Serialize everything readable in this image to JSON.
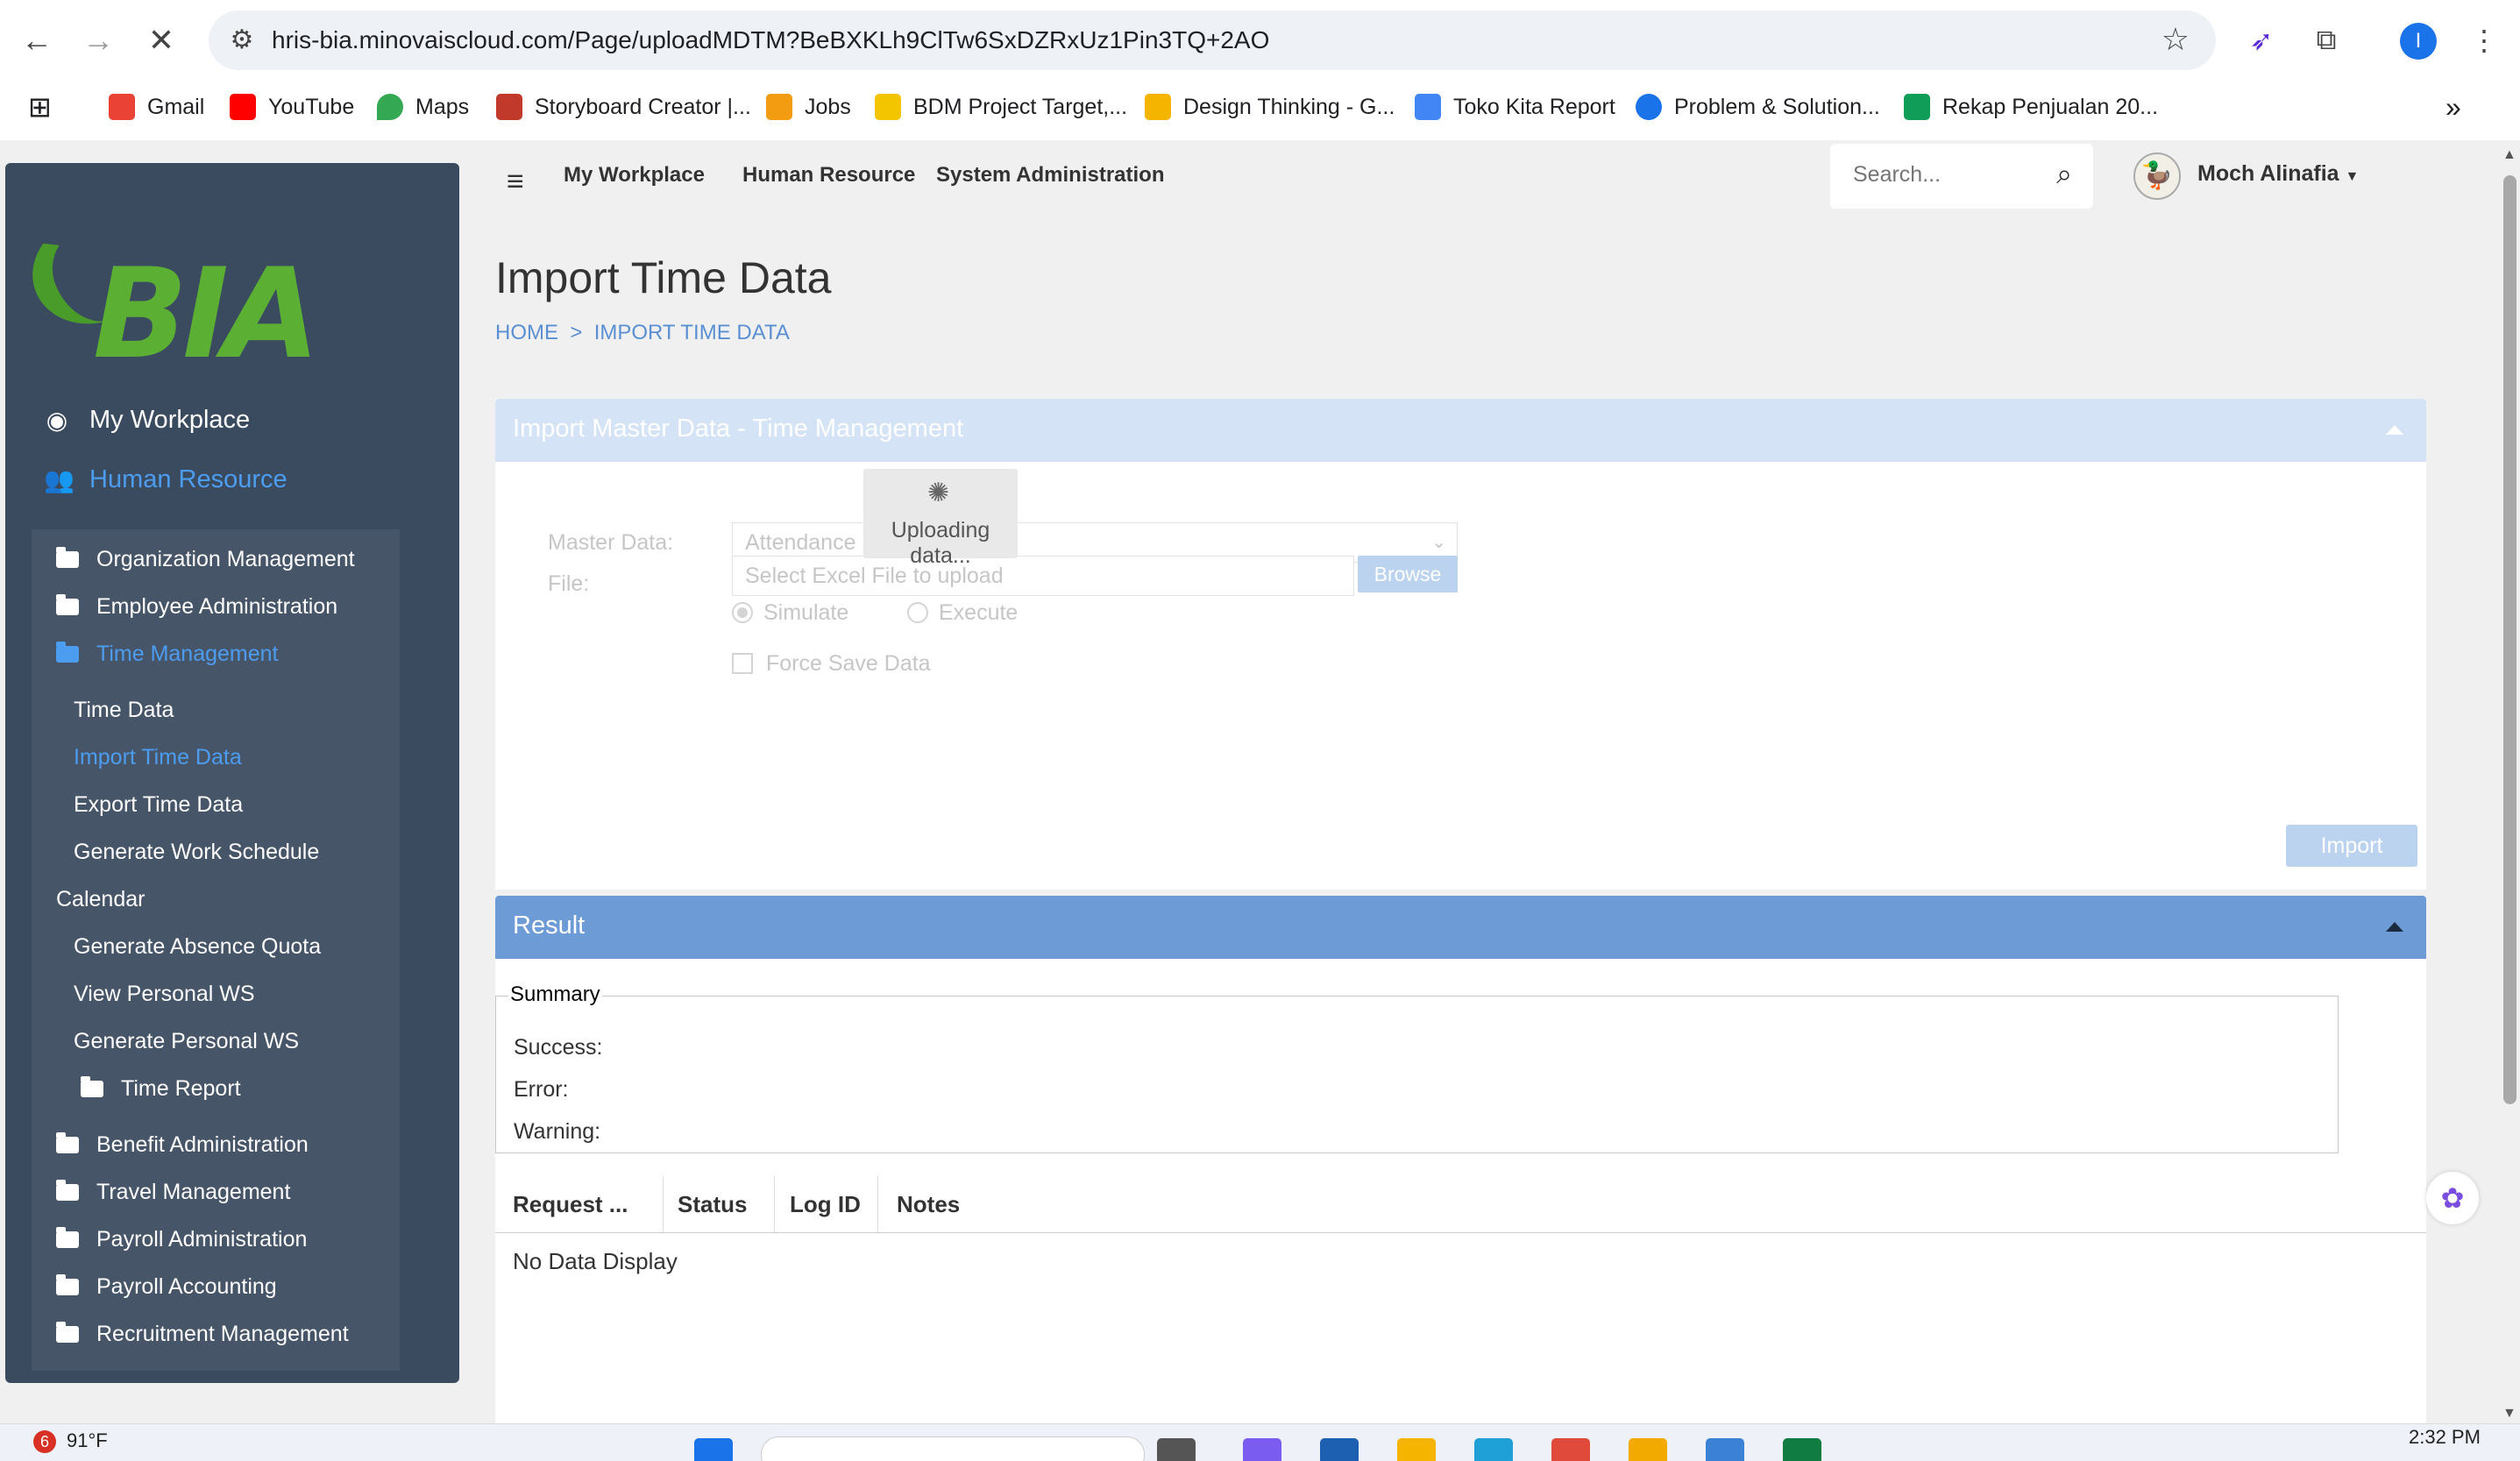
{
  "browser": {
    "url": "hris-bia.minovaiscloud.com/Page/uploadMDTM?BeBXKLh9ClTw6SxDZRxUz1Pin3TQ+2AO",
    "profile_initial": "I",
    "bookmarks": [
      {
        "label": "Gmail",
        "color": "#ea4335"
      },
      {
        "label": "YouTube",
        "color": "#ff0000"
      },
      {
        "label": "Maps",
        "color": "#34a853"
      },
      {
        "label": "Storyboard Creator |...",
        "color": "#c0392b"
      },
      {
        "label": "Jobs",
        "color": "#f39c12"
      },
      {
        "label": "BDM Project Target,...",
        "color": "#111111"
      },
      {
        "label": "Design Thinking - G...",
        "color": "#f4b400"
      },
      {
        "label": "Toko Kita Report",
        "color": "#4285f4"
      },
      {
        "label": "Problem & Solution...",
        "color": "#1a73e8"
      },
      {
        "label": "Rekap Penjualan 20...",
        "color": "#0f9d58"
      }
    ],
    "more_label": "»"
  },
  "sidebar": {
    "logo_text": "BIA",
    "top_items": [
      {
        "label": "My Workplace"
      },
      {
        "label": "Human Resource"
      }
    ],
    "submenu": [
      {
        "label": "Organization Management"
      },
      {
        "label": "Employee Administration"
      },
      {
        "label": "Time Management"
      }
    ],
    "time_children": [
      {
        "label": "Time Data"
      },
      {
        "label": "Import Time Data"
      },
      {
        "label": "Export Time Data"
      },
      {
        "label": "Generate Work Schedule"
      },
      {
        "label": "Calendar"
      },
      {
        "label": "Generate Absence Quota"
      },
      {
        "label": "View Personal WS"
      },
      {
        "label": "Generate Personal WS"
      },
      {
        "label": "Time Report"
      }
    ],
    "submenu_after": [
      {
        "label": "Benefit Administration"
      },
      {
        "label": "Travel Management"
      },
      {
        "label": "Payroll Administration"
      },
      {
        "label": "Payroll Accounting"
      },
      {
        "label": "Recruitment Management"
      }
    ]
  },
  "topbar": {
    "nav": [
      "My Workplace",
      "Human Resource",
      "System Administration"
    ],
    "search_placeholder": "Search...",
    "user_name": "Moch Alinafia"
  },
  "content": {
    "page_title": "Import Time Data",
    "breadcrumb": "HOME  >  IMPORT TIME DATA",
    "import_panel": {
      "title": "Import Master Data - Time Management",
      "master_data_label": "Master Data:",
      "master_data_value": "Attendance",
      "file_label": "File:",
      "file_placeholder": "Select Excel File to upload",
      "browse_label": "Browse",
      "simulate_label": "Simulate",
      "execute_label": "Execute",
      "force_save_label": "Force Save Data",
      "loading_text": "Uploading data...",
      "import_label": "Import"
    },
    "result_panel": {
      "title": "Result",
      "summary_label": "Summary",
      "success_label": "Success:",
      "error_label": "Error:",
      "warning_label": "Warning:",
      "columns": [
        "Request ...",
        "Status",
        "Log ID",
        "Notes"
      ],
      "empty_text": "No Data Display"
    }
  },
  "taskbar": {
    "notification_count": "6",
    "weather": "91°F",
    "time": "2:32 PM"
  }
}
